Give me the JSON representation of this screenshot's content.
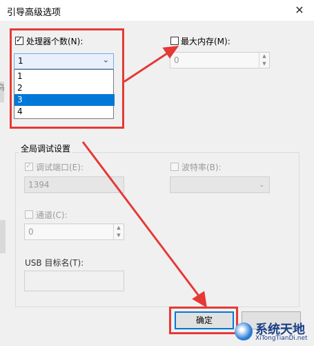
{
  "window": {
    "title": "引导高级选项",
    "close_glyph": "✕"
  },
  "processors": {
    "checkbox_label": "处理器个数(N):",
    "checked": true,
    "selected_value": "1",
    "options": [
      "1",
      "2",
      "3",
      "4"
    ],
    "highlighted_option": "3"
  },
  "max_memory": {
    "checkbox_label": "最大内存(M):",
    "checked": false,
    "value": "0"
  },
  "global_debug": {
    "group_label": "全局调试设置",
    "debug_port_label": "调试端口(E):",
    "debug_port_value": "1394",
    "baud_rate_label": "波特率(B):",
    "channel_label": "通道(C):",
    "channel_value": "0",
    "usb_target_label": "USB 目标名(T):",
    "usb_target_value": ""
  },
  "buttons": {
    "ok_label": "确定"
  },
  "left_edge_fragment": "乌",
  "watermark": {
    "brand": "系统天地",
    "url": "XiTongTianDi.net"
  },
  "colors": {
    "accent": "#0078d7",
    "annotation_red": "#e53935"
  },
  "icons": [
    "close-icon",
    "chevron-down-icon",
    "spin-up-icon",
    "spin-down-icon",
    "checkmark-icon",
    "watermark-logo-icon"
  ]
}
